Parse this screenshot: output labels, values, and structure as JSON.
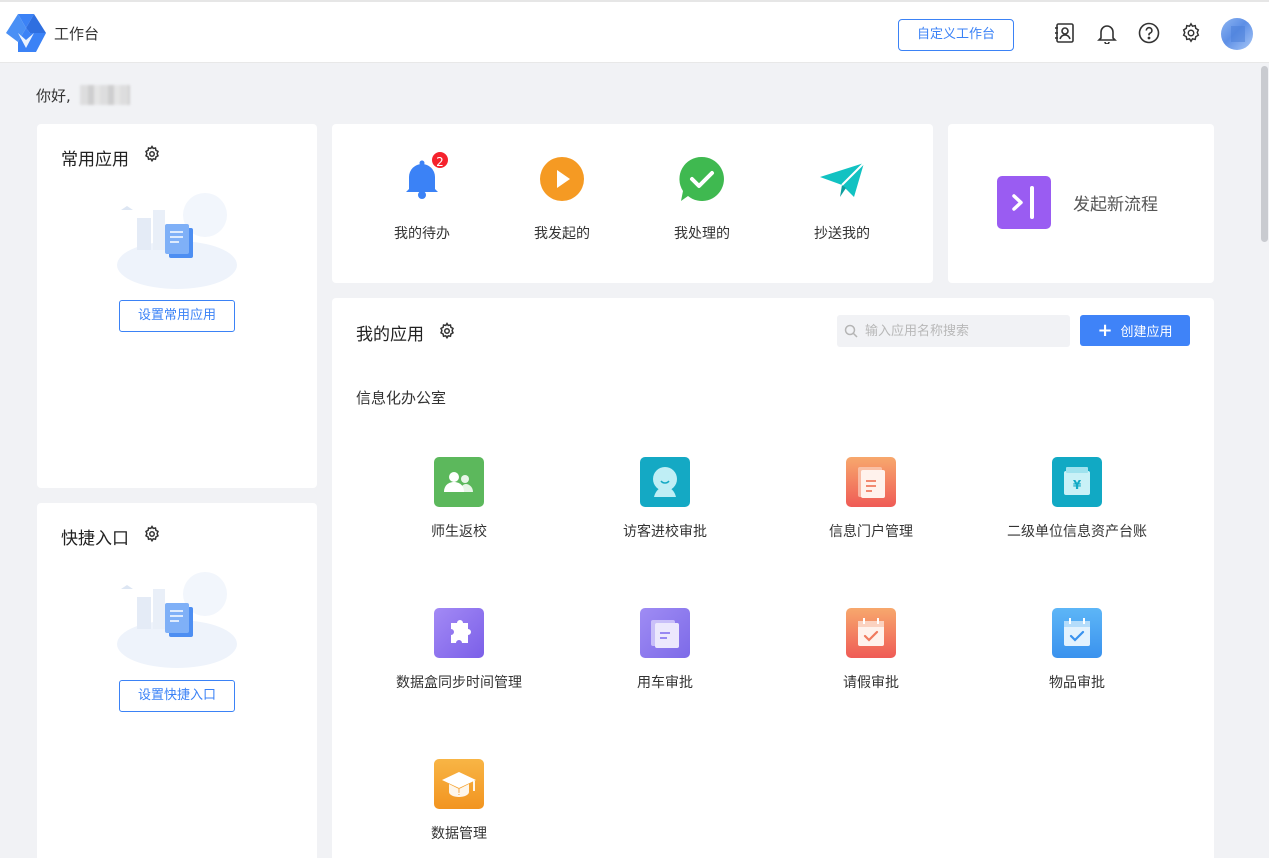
{
  "header": {
    "title": "工作台",
    "customize_label": "自定义工作台"
  },
  "greeting": "你好,",
  "common_apps": {
    "title": "常用应用",
    "setup_label": "设置常用应用"
  },
  "shortcuts": {
    "title": "快捷入口",
    "setup_label": "设置快捷入口"
  },
  "quick_actions": [
    {
      "label": "我的待办",
      "badge": "2",
      "icon": "bell-icon",
      "color": "#3b82f6"
    },
    {
      "label": "我发起的",
      "icon": "play-icon",
      "color": "#f59a23"
    },
    {
      "label": "我处理的",
      "icon": "check-icon",
      "color": "#3fb950"
    },
    {
      "label": "抄送我的",
      "icon": "send-icon",
      "color": "#12c2c2"
    }
  ],
  "new_flow": {
    "label": "发起新流程",
    "color": "#9a5cf2"
  },
  "my_apps": {
    "title": "我的应用",
    "search_placeholder": "输入应用名称搜索",
    "create_label": "创建应用",
    "group_title": "信息化办公室",
    "apps": [
      {
        "label": "师生返校",
        "icon": "people-icon",
        "color": "#5cb85c"
      },
      {
        "label": "访客进校审批",
        "icon": "visitor-icon",
        "color": "#14a9c4"
      },
      {
        "label": "信息门户管理",
        "icon": "portal-icon",
        "color": "#f06a5a"
      },
      {
        "label": "二级单位信息资产台账",
        "icon": "ledger-icon",
        "color": "#11a9c4"
      },
      {
        "label": "数据盒同步时间管理",
        "icon": "puzzle-icon",
        "color": "#8e6df0"
      },
      {
        "label": "用车审批",
        "icon": "car-doc-icon",
        "color": "#8c7af0"
      },
      {
        "label": "请假审批",
        "icon": "calendar-icon",
        "color": "#f06a5a"
      },
      {
        "label": "物品审批",
        "icon": "calendar-check-icon",
        "color": "#3da0f0"
      },
      {
        "label": "数据管理",
        "icon": "graduation-cap-icon",
        "color": "#f5a623"
      }
    ]
  }
}
